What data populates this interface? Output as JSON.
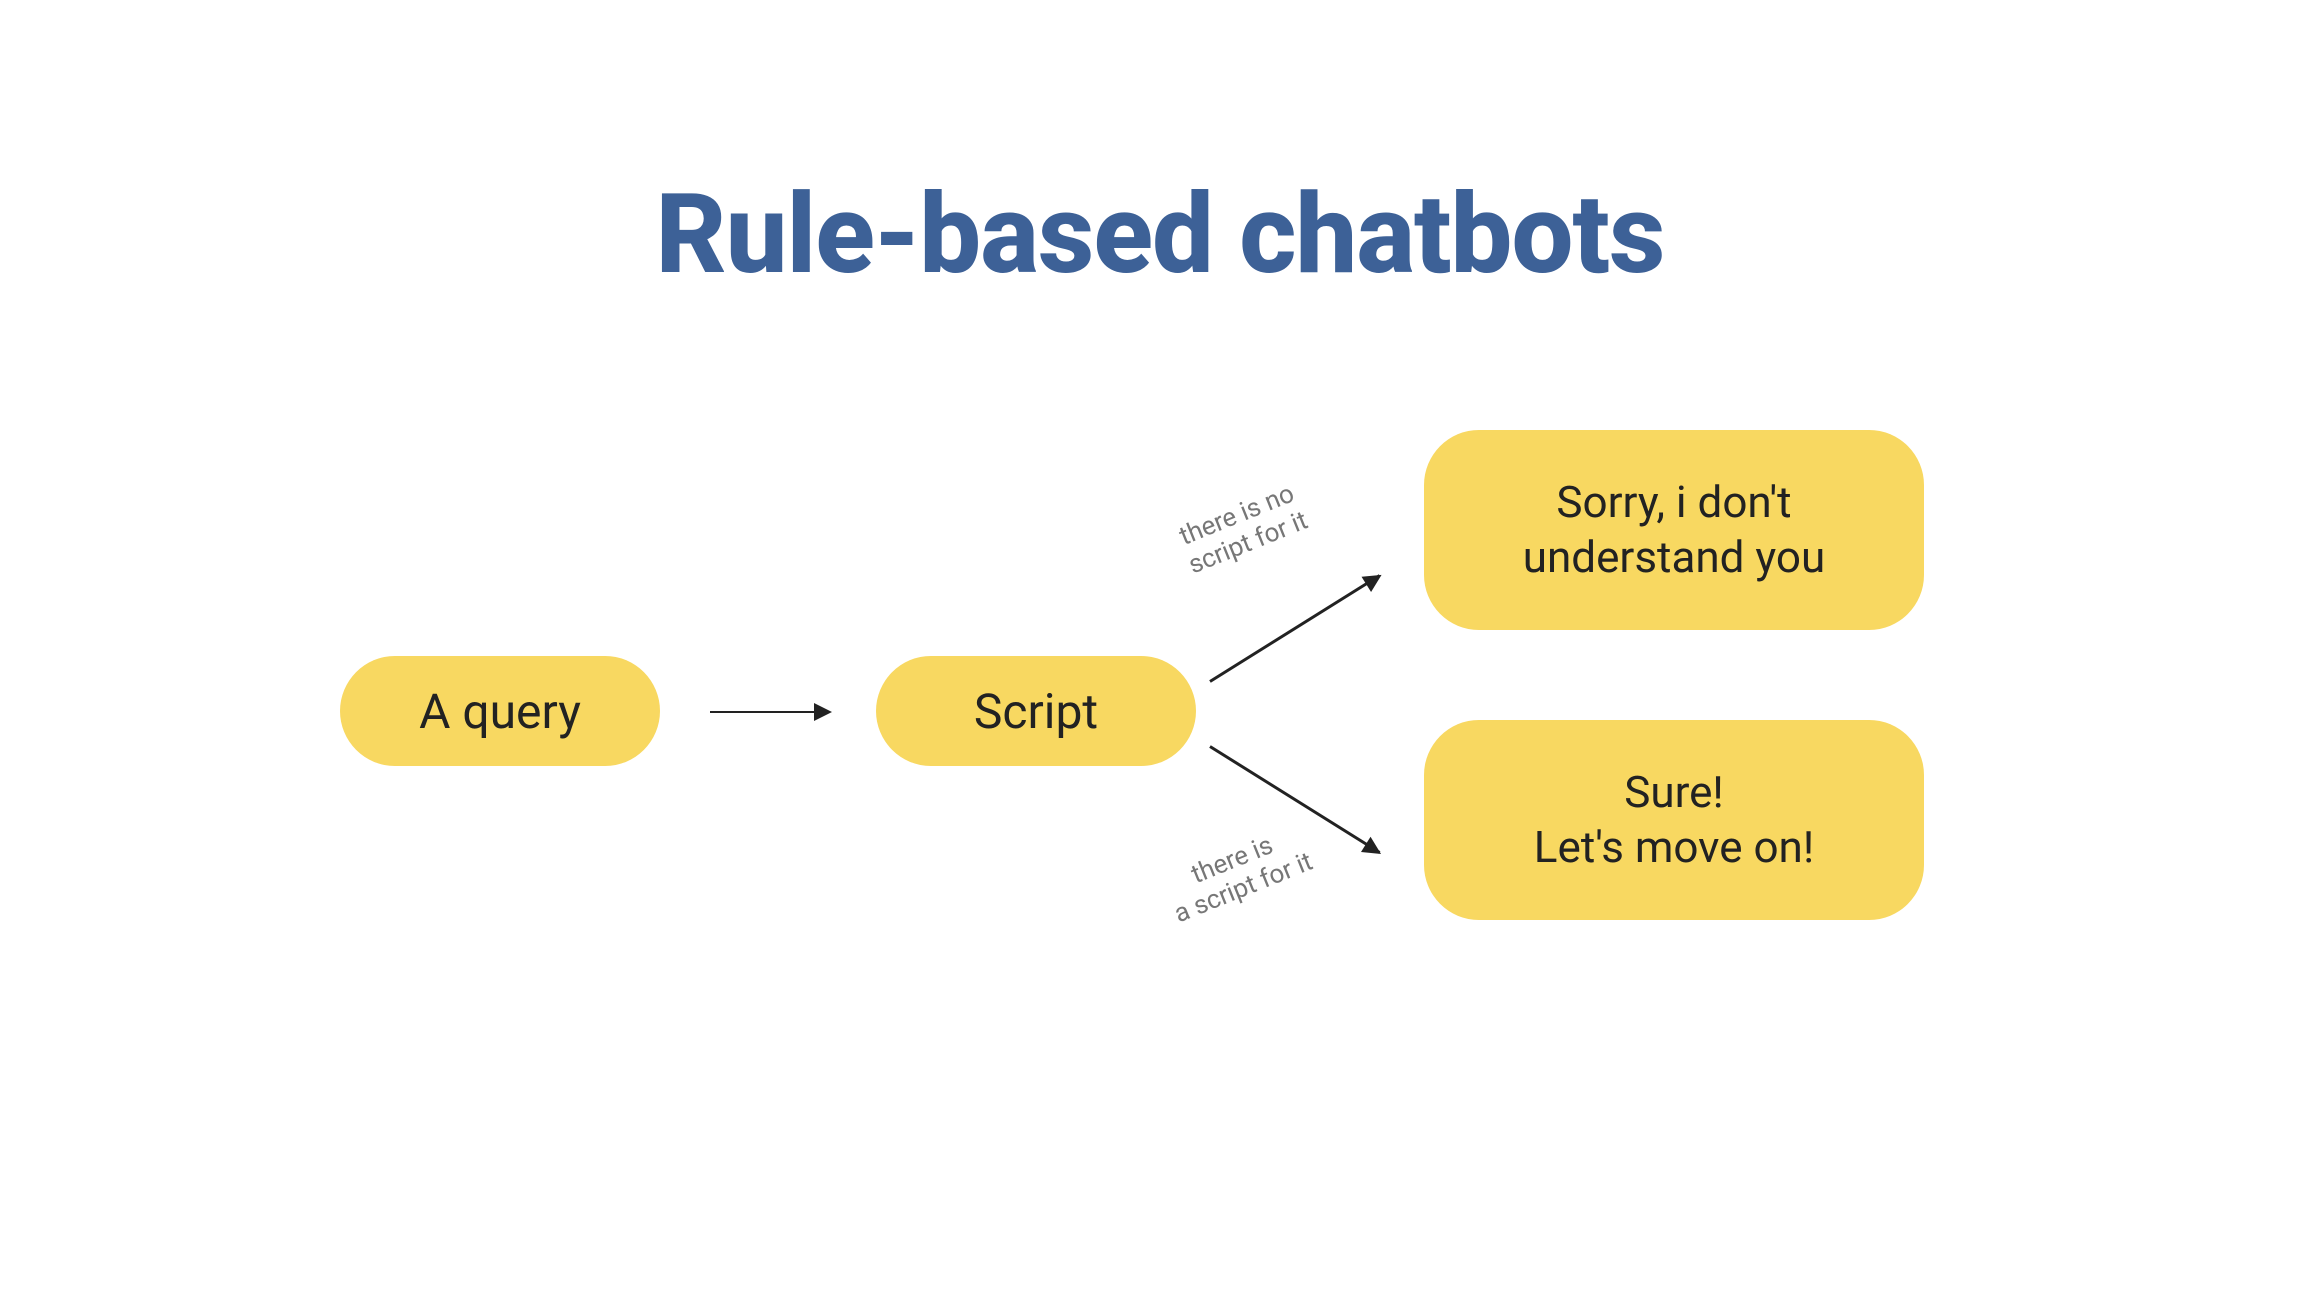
{
  "title": "Rule-based chatbots",
  "nodes": {
    "query": {
      "label": "A query"
    },
    "script": {
      "label": "Script"
    },
    "sorry": {
      "label": "Sorry, i don't\nunderstand you"
    },
    "sure": {
      "label": "Sure!\nLet's move on!"
    }
  },
  "edges": {
    "query_to_script": {
      "label": ""
    },
    "script_to_sorry": {
      "label": "there is no\nscript for it"
    },
    "script_to_sure": {
      "label": "there is\na script for it"
    }
  },
  "colors": {
    "title": "#3D6197",
    "pill_bg": "#F8D861",
    "text": "#222222",
    "edge_label": "#777777"
  }
}
